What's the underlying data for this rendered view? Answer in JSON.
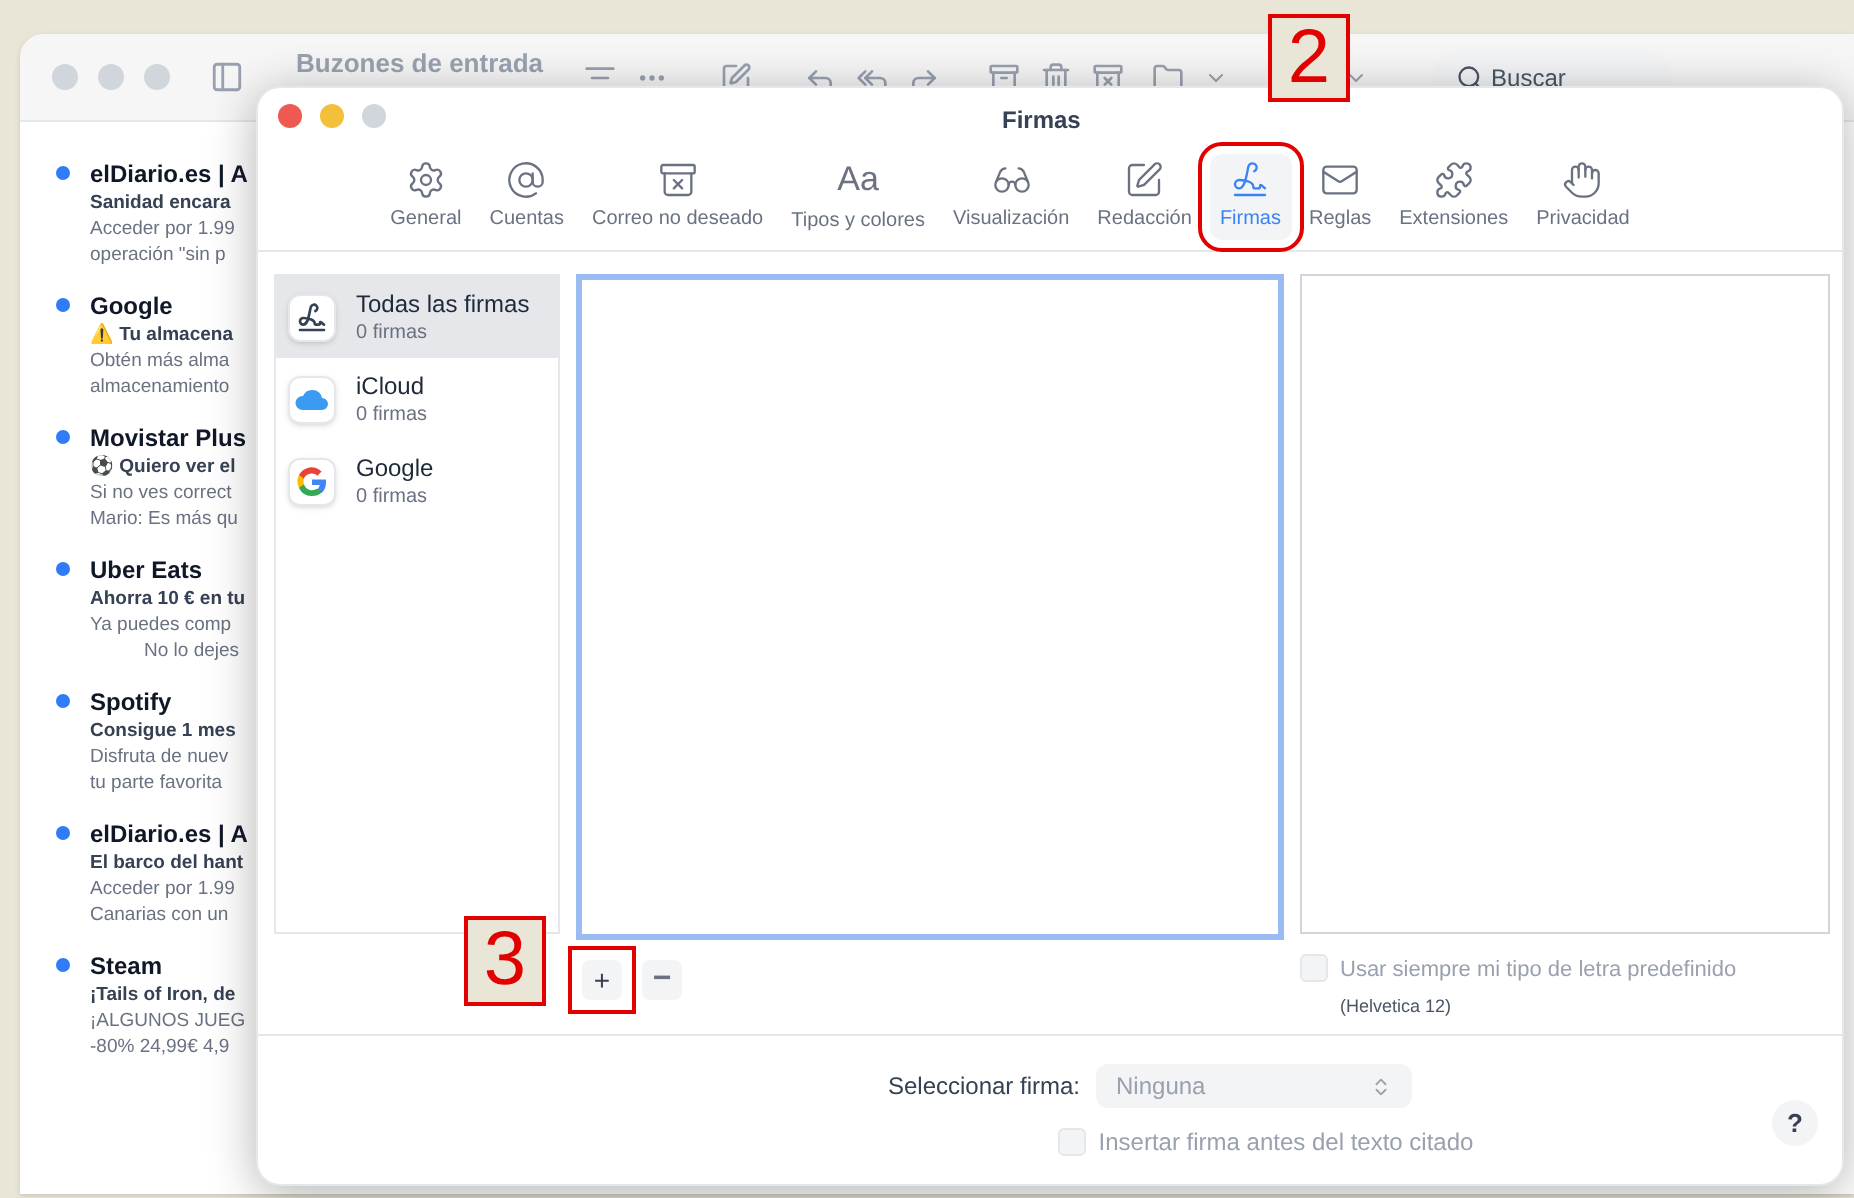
{
  "mail_window": {
    "title": "Buzones de entrada",
    "search": {
      "placeholder": "Buscar"
    },
    "messages": [
      {
        "sender": "elDiario.es | A",
        "subject": "Sanidad encara",
        "preview": [
          "Acceder por 1.99",
          "operación \"sin p"
        ],
        "unread": true
      },
      {
        "sender": "Google",
        "subject": "⚠️ Tu almacena",
        "preview": [
          "Obtén más alma",
          "almacenamiento"
        ],
        "unread": true
      },
      {
        "sender": "Movistar Plus",
        "subject": "⚽ Quiero ver el",
        "preview": [
          "Si no ves correct",
          "Mario: Es más qu"
        ],
        "unread": true
      },
      {
        "sender": "Uber Eats",
        "subject": "Ahorra 10 € en tu",
        "preview": [
          "Ya puedes comp",
          "No lo dejes"
        ],
        "unread": true
      },
      {
        "sender": "Spotify",
        "subject": "Consigue 1 mes",
        "preview": [
          "Disfruta de nuev",
          "tu parte favorita"
        ],
        "unread": true
      },
      {
        "sender": "elDiario.es | A",
        "subject": "El barco del hant",
        "preview": [
          "Acceder por 1.99",
          "Canarias con un"
        ],
        "unread": true
      },
      {
        "sender": "Steam",
        "subject": "¡Tails of Iron, de",
        "preview": [
          "¡ALGUNOS JUEG",
          "-80% 24,99€ 4,9"
        ],
        "unread": true
      }
    ]
  },
  "dialog": {
    "title": "Firmas",
    "tabs": [
      {
        "label": "General",
        "selected": false,
        "highlighted": false
      },
      {
        "label": "Cuentas",
        "selected": false,
        "highlighted": false
      },
      {
        "label": "Correo no deseado",
        "selected": false,
        "highlighted": false
      },
      {
        "label": "Tipos y colores",
        "icon_text": "Aa",
        "selected": false,
        "highlighted": false
      },
      {
        "label": "Visualización",
        "selected": false,
        "highlighted": false
      },
      {
        "label": "Redacción",
        "selected": false,
        "highlighted": false
      },
      {
        "label": "Firmas",
        "selected": true,
        "highlighted": true
      },
      {
        "label": "Reglas",
        "selected": false,
        "highlighted": false
      },
      {
        "label": "Extensiones",
        "selected": false,
        "highlighted": false
      },
      {
        "label": "Privacidad",
        "selected": false,
        "highlighted": false
      }
    ],
    "accounts": [
      {
        "kind": "all",
        "name": "Todas las firmas",
        "count": "0 firmas",
        "selected": true
      },
      {
        "kind": "icloud",
        "name": "iCloud",
        "count": "0 firmas",
        "selected": false
      },
      {
        "kind": "google",
        "name": "Google",
        "count": "0 firmas",
        "selected": false
      }
    ],
    "add_button": {
      "label": "+",
      "highlighted": true
    },
    "remove_button": {
      "label": "−",
      "disabled": true
    },
    "default_font": {
      "label": "Usar siempre mi tipo de letra predefinido",
      "checked": false,
      "disabled": true,
      "note": "(Helvetica 12)"
    },
    "select_signature": {
      "label": "Seleccionar firma:",
      "value": "Ninguna",
      "disabled": true
    },
    "insert_before_quote": {
      "label": "Insertar firma antes del texto citado",
      "checked": false,
      "disabled": true
    },
    "help_button": {
      "label": "?"
    }
  },
  "annotations": [
    {
      "label": "2"
    },
    {
      "label": "3"
    }
  ]
}
